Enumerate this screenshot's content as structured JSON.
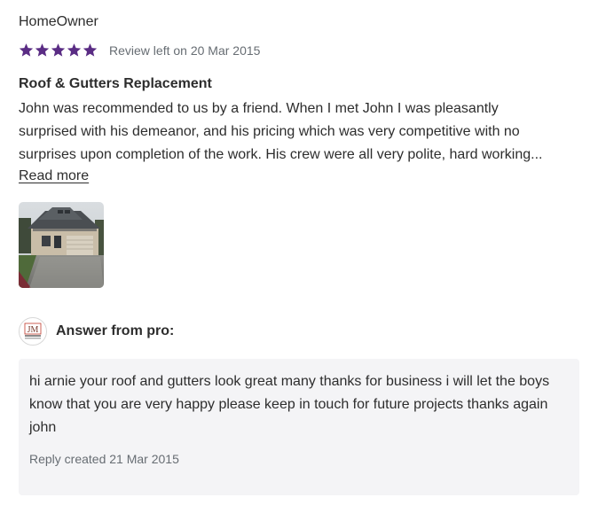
{
  "review": {
    "reviewer_name": "HomeOwner",
    "stars": 5,
    "star_color": "#5a2c84",
    "date_text": "Review left on 20 Mar 2015",
    "title": "Roof & Gutters Replacement",
    "body_lines": [
      "John was recommended to us by a friend. When I met John I was pleasantly",
      "surprised with his demeanor, and his pricing which was very competitive with no",
      "surprises upon completion of the work. His crew were all very polite, hard working..."
    ],
    "read_more_label": "Read more",
    "photo_alt": "House with new roof and gutters"
  },
  "answer": {
    "label": "Answer from pro:",
    "logo_text": "JM",
    "body": "hi arnie your roof and gutters look great many thanks for business i will let the boys know that you are very happy please keep in touch for future projects thanks again john",
    "reply_date_text": "Reply created 21 Mar 2015"
  }
}
